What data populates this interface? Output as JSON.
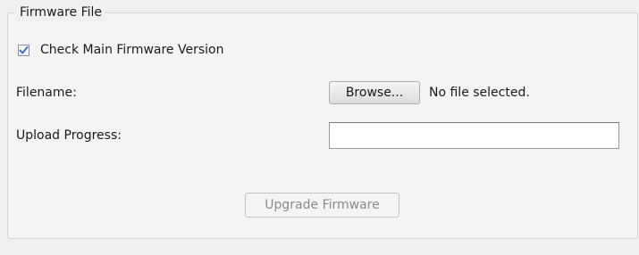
{
  "firmware_file": {
    "legend": "Firmware File",
    "check_main": {
      "label": "Check Main Firmware Version",
      "checked": true
    },
    "filename": {
      "label": "Filename:",
      "browse_label": "Browse...",
      "status": "No file selected."
    },
    "upload_progress": {
      "label": "Upload Progress:",
      "percent": 0
    },
    "upgrade_button": {
      "label": "Upgrade Firmware",
      "enabled": false
    }
  },
  "colors": {
    "background": "#f0f0f0",
    "checkmark": "#3a5fcd",
    "disabled_text": "#8a8a8a",
    "progress_fill": "#2f8ad8"
  }
}
